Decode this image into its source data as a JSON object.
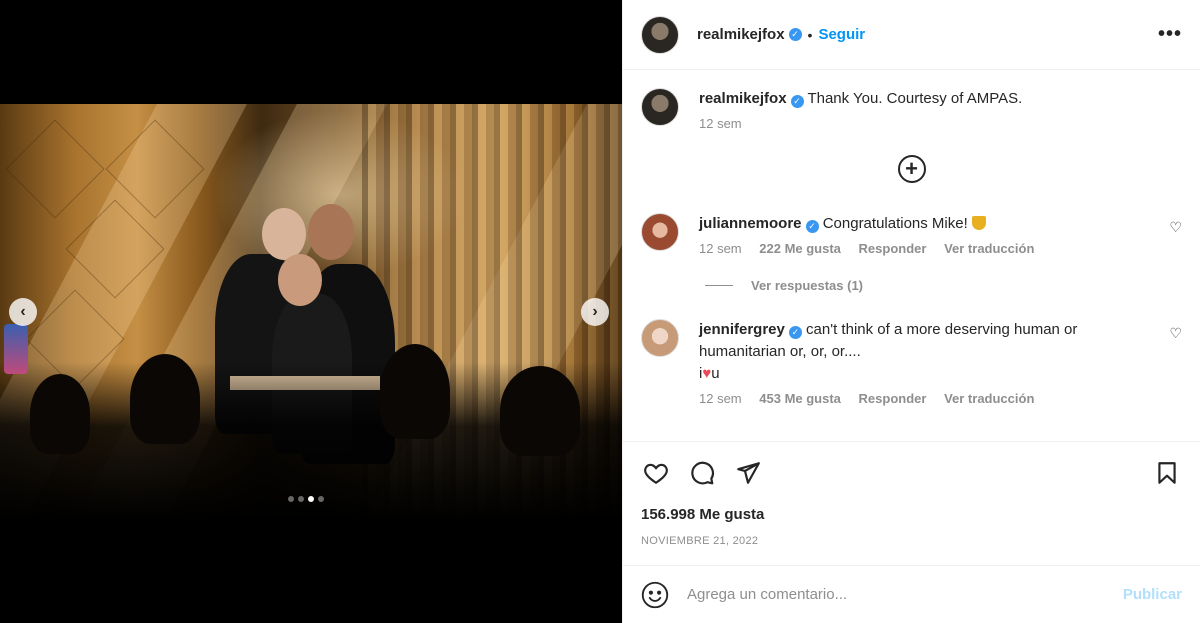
{
  "post": {
    "author": "realmikejfox",
    "separator": "•",
    "follow_label": "Seguir",
    "more_label": "•••",
    "caption_text": "Thank You. Courtesy of AMPAS.",
    "caption_time": "12 sem",
    "likes": "156.998 Me gusta",
    "date": "NOVIEMBRE 21, 2022"
  },
  "media": {
    "prev_label": "‹",
    "next_label": "›",
    "slide_count": 4,
    "active_slide": 3
  },
  "comments": [
    {
      "username": "juliannemoore",
      "text": "Congratulations Mike!",
      "time": "12 sem",
      "likes": "222 Me gusta",
      "reply": "Responder",
      "translate": "Ver traducción",
      "view_replies": "Ver respuestas (1)"
    },
    {
      "username": "jennifergrey",
      "text": "can't think of a more deserving human or humanitarian or, or, or....",
      "text_prefix": "i",
      "text_suffix": "u",
      "time": "12 sem",
      "likes": "453 Me gusta",
      "reply": "Responder",
      "translate": "Ver traducción"
    }
  ],
  "icons": {
    "heart": "heart-icon",
    "comment": "comment-icon",
    "share": "share-icon",
    "save": "bookmark-icon",
    "emoji": "emoji-icon",
    "add": "plus-circle-icon"
  },
  "add_comment": {
    "placeholder": "Agrega un comentario...",
    "publish_label": "Publicar"
  },
  "colors": {
    "link": "#0095f6",
    "verified": "#3897f0",
    "publish_disabled": "#b2dffc",
    "muted": "#8e8e8e"
  }
}
